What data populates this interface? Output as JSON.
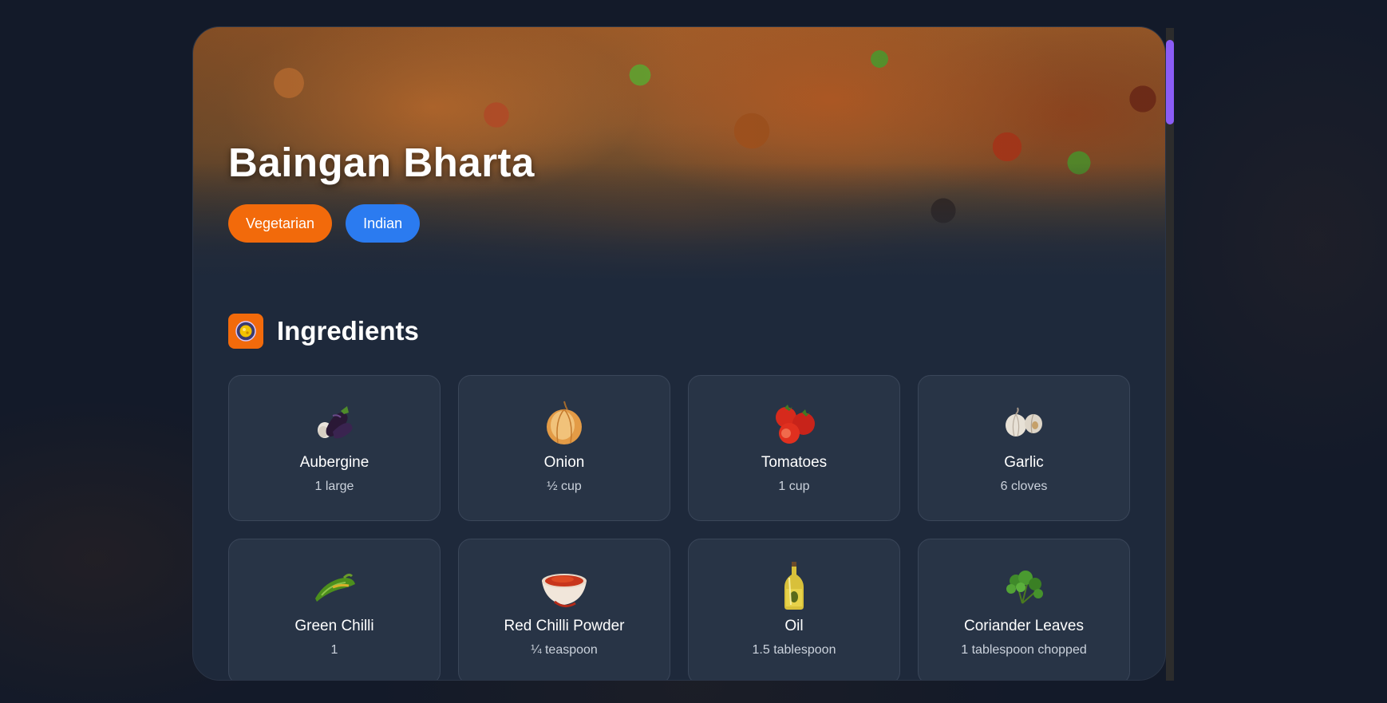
{
  "recipe": {
    "title": "Baingan Bharta",
    "tags": [
      {
        "label": "Vegetarian",
        "color": "#f26a0b"
      },
      {
        "label": "Indian",
        "color": "#2b7bf0"
      }
    ]
  },
  "ingredients_section": {
    "heading": "Ingredients",
    "icon": "plate-icon",
    "items": [
      {
        "name": "Aubergine",
        "quantity": "1 large",
        "icon": "aubergine-icon"
      },
      {
        "name": "Onion",
        "quantity": "½ cup",
        "icon": "onion-icon"
      },
      {
        "name": "Tomatoes",
        "quantity": "1 cup",
        "icon": "tomatoes-icon"
      },
      {
        "name": "Garlic",
        "quantity": "6 cloves",
        "icon": "garlic-icon"
      },
      {
        "name": "Green Chilli",
        "quantity": "1",
        "icon": "green-chilli-icon"
      },
      {
        "name": "Red Chilli Powder",
        "quantity": "¼ teaspoon",
        "icon": "red-chilli-powder-icon"
      },
      {
        "name": "Oil",
        "quantity": "1.5 tablespoon",
        "icon": "oil-bottle-icon"
      },
      {
        "name": "Coriander Leaves",
        "quantity": "1 tablespoon chopped",
        "icon": "coriander-leaves-icon"
      }
    ]
  },
  "theme": {
    "background": "#131a29",
    "panel": "#1e293b",
    "card": "#283446",
    "scrollbar_thumb": "#8b5cf6"
  }
}
